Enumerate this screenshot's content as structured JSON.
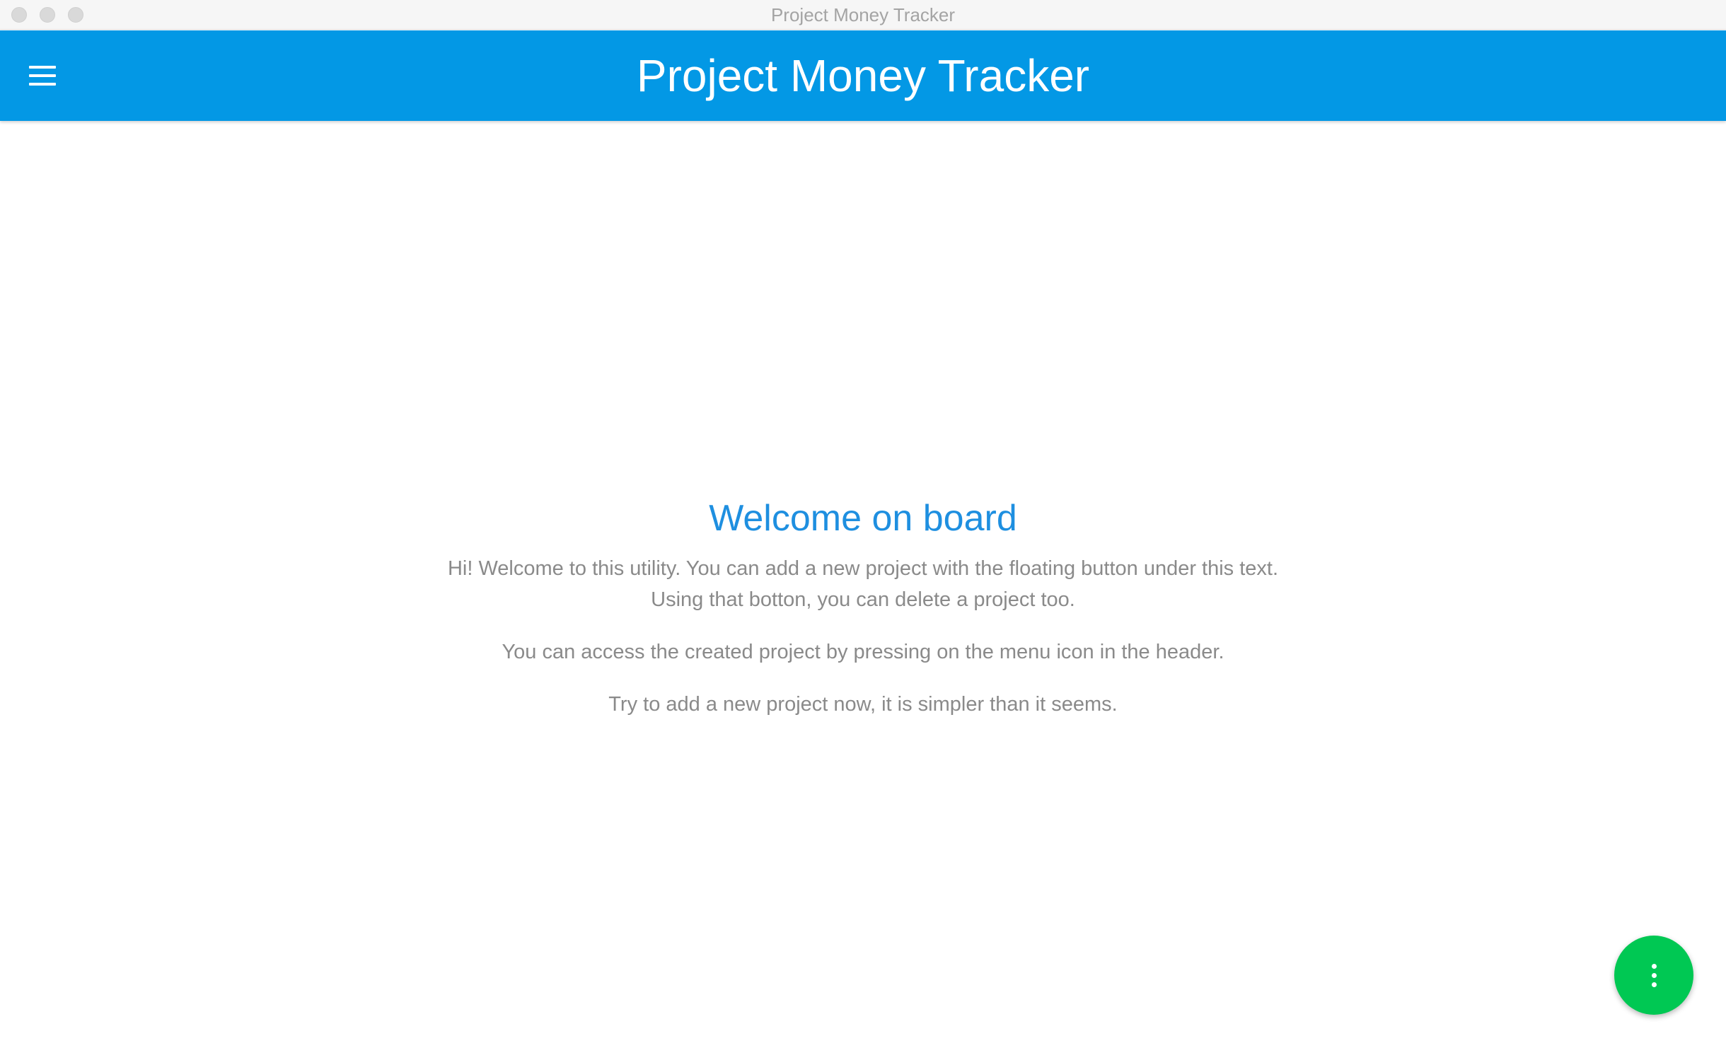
{
  "window": {
    "title": "Project Money Tracker"
  },
  "header": {
    "title": "Project Money Tracker",
    "menu_icon": "hamburger-menu-icon",
    "background_color": "#0398e5"
  },
  "welcome": {
    "heading": "Welcome on board",
    "paragraph_1_line_1": "Hi! Welcome to this utility. You can add a new project with the floating button under this text.",
    "paragraph_1_line_2": "Using that botton, you can delete a project too.",
    "paragraph_2": "You can access the created project by pressing on the menu icon in the header.",
    "paragraph_3": "Try to add a new project now, it is simpler than it seems.",
    "heading_color": "#1e8fe0",
    "text_color": "#8a8a8a"
  },
  "fab": {
    "icon": "more-vertical-icon",
    "color": "#00c853"
  }
}
